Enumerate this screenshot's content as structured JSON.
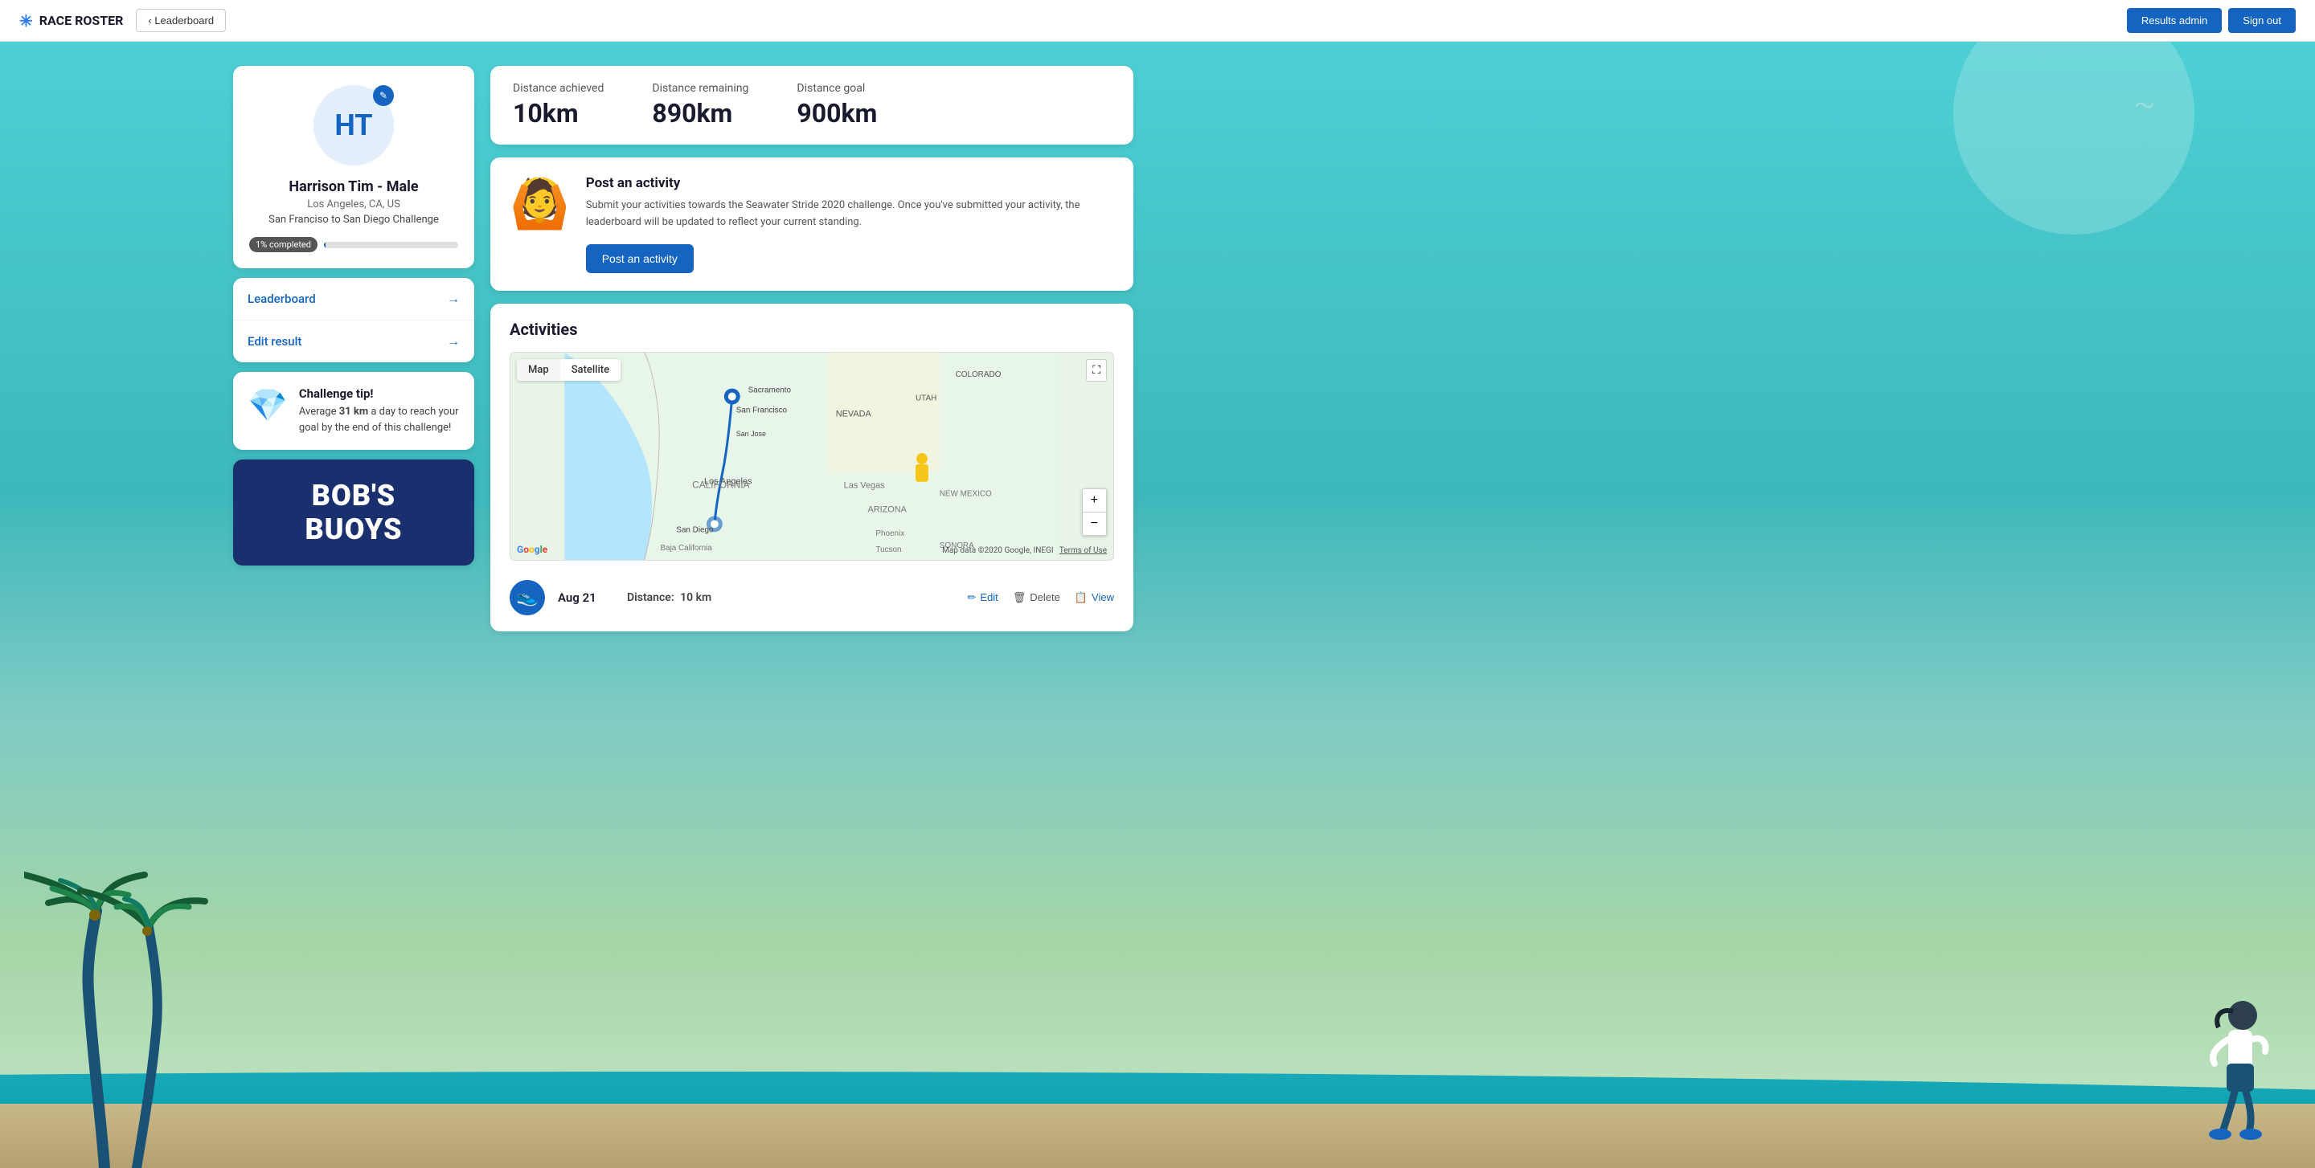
{
  "header": {
    "logo_text": "RACE ROSTER",
    "back_label": "‹ Leaderboard",
    "results_admin_label": "Results admin",
    "sign_out_label": "Sign out"
  },
  "profile": {
    "initials": "HT",
    "name": "Harrison Tim - Male",
    "location": "Los Angeles, CA, US",
    "challenge": "San Franciso to San Diego Challenge",
    "progress_label": "1% completed",
    "progress_pct": 1,
    "edit_icon": "✎"
  },
  "nav": {
    "leaderboard_label": "Leaderboard",
    "edit_result_label": "Edit result"
  },
  "tip": {
    "title": "Challenge tip!",
    "text_before": "Average ",
    "highlight": "31 km",
    "text_after": " a day to reach your goal by the end of this challenge!"
  },
  "bobs": {
    "line1": "BOB'S",
    "line2": "BUOYS"
  },
  "stats": {
    "distance_achieved_label": "Distance achieved",
    "distance_achieved_value": "10km",
    "distance_remaining_label": "Distance remaining",
    "distance_remaining_value": "890km",
    "distance_goal_label": "Distance goal",
    "distance_goal_value": "900km"
  },
  "post_activity": {
    "title": "Post an activity",
    "description": "Submit your activities towards the Seawater Stride 2020 challenge. Once you've submitted your activity, the leaderboard will be updated to reflect your current standing.",
    "button_label": "Post an activity"
  },
  "activities": {
    "section_title": "Activities",
    "map_tab_map": "Map",
    "map_tab_satellite": "Satellite",
    "map_attribution": "Map data ©2020 Google, INEGI",
    "map_terms": "Terms of Use",
    "google_label": "Google",
    "zoom_in": "+",
    "zoom_out": "−",
    "items": [
      {
        "date": "Aug 21",
        "distance_label": "Distance:",
        "distance_value": "10 km",
        "edit_label": "Edit",
        "delete_label": "Delete",
        "view_label": "View"
      }
    ]
  },
  "icons": {
    "pencil": "✎",
    "edit": "✏",
    "trash": "🗑",
    "book": "📋",
    "arrow_right": "→",
    "diamond": "💎",
    "shoe": "👟",
    "person": "🧍",
    "fullscreen": "⛶"
  },
  "colors": {
    "primary": "#1565c0",
    "header_bg": "#ffffff",
    "card_bg": "#ffffff",
    "progress_fill": "#1565c0",
    "accent_teal": "#4dd0d4",
    "dark_navy": "#1a2f6e"
  }
}
